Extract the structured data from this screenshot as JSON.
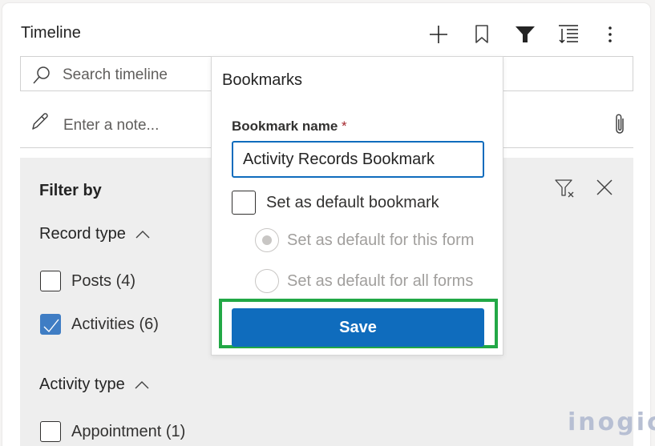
{
  "header": {
    "title": "Timeline",
    "toolbar": [
      {
        "icon": "plus-icon",
        "label": "Create a timeline record"
      },
      {
        "icon": "bookmark-icon",
        "label": "Bookmarks"
      },
      {
        "icon": "filter-icon",
        "label": "Filter"
      },
      {
        "icon": "sort-icon",
        "label": "Sort"
      },
      {
        "icon": "more-icon",
        "label": "More commands"
      }
    ]
  },
  "search": {
    "placeholder": "Search timeline"
  },
  "note": {
    "placeholder": "Enter a note..."
  },
  "filter": {
    "title": "Filter by",
    "sections": [
      {
        "label": "Record type",
        "expanded": true,
        "options": [
          {
            "label": "Posts (4)",
            "checked": false
          },
          {
            "label": "Activities (6)",
            "checked": true
          }
        ]
      },
      {
        "label": "Activity type",
        "expanded": true,
        "options": [
          {
            "label": "Appointment (1)",
            "checked": false
          }
        ]
      }
    ]
  },
  "bookmarks": {
    "title": "Bookmarks",
    "field_label": "Bookmark name",
    "required_marker": "*",
    "name_value": "Activity Records Bookmark",
    "default_checkbox": {
      "label": "Set as default bookmark",
      "checked": false
    },
    "radios": [
      {
        "label": "Set as default for this form",
        "selected": true,
        "disabled": true
      },
      {
        "label": "Set as default for all forms",
        "selected": false,
        "disabled": true
      }
    ],
    "save_label": "Save"
  },
  "colors": {
    "primary": "#0f6cbd",
    "highlight": "#22a846",
    "checkbox_checked": "#3f7dc4"
  },
  "watermark": "inogic"
}
